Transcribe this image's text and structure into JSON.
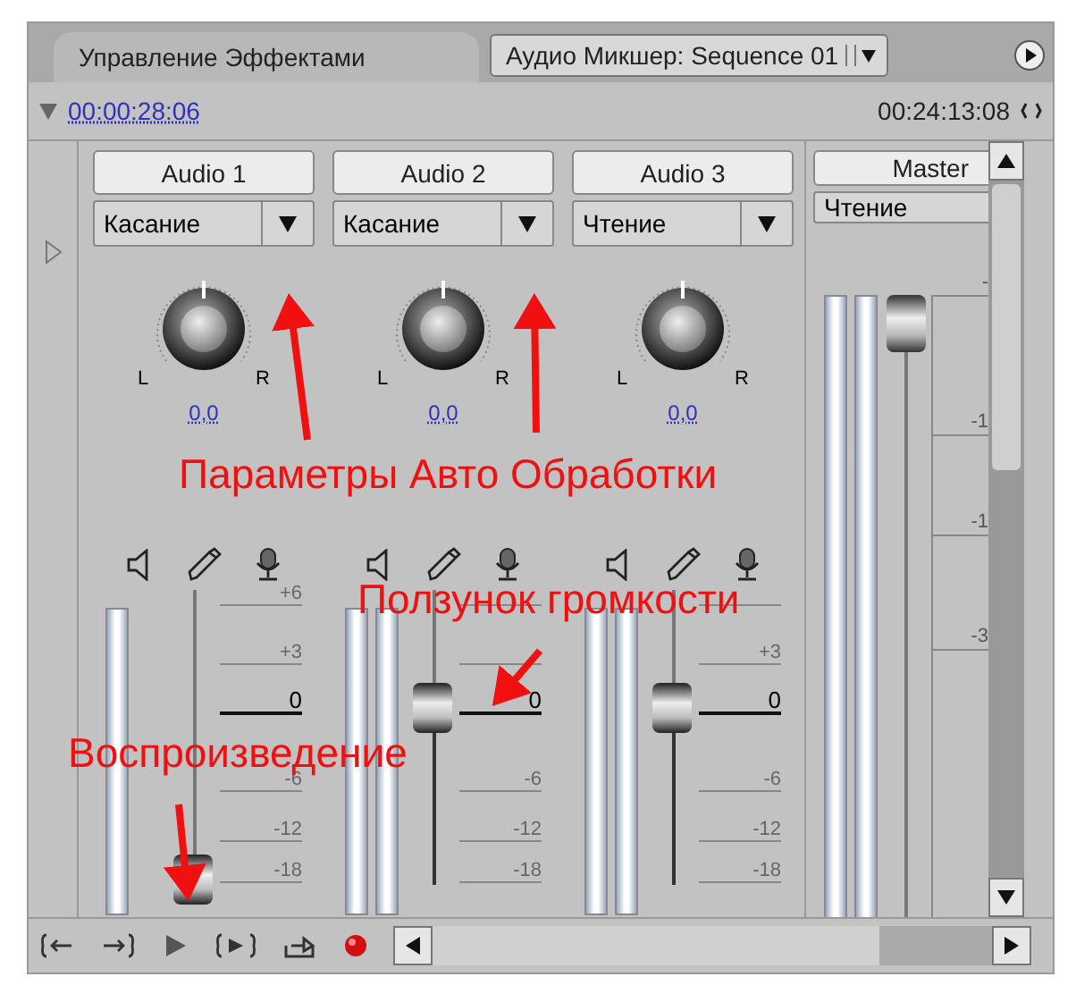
{
  "tabs": [
    {
      "label": "Управление Эффектами",
      "selected": false
    },
    {
      "label": "Аудио Микшер: Sequence 01",
      "selected": true
    }
  ],
  "timecodes": {
    "current": "00:00:28:06",
    "duration": "00:24:13:08"
  },
  "channels": [
    {
      "name": "Audio 1",
      "mode": "Касание",
      "left": "L",
      "right": "R",
      "pan": "0,0",
      "kind": "mono",
      "level": 0.02,
      "ticks": [
        {
          "kind": "p6",
          "label": "+6"
        },
        {
          "kind": "p3",
          "label": "+3"
        },
        {
          "kind": "zero",
          "label": "0"
        },
        {
          "kind": "m6",
          "label": "-6"
        },
        {
          "kind": "m12",
          "label": "-12"
        },
        {
          "kind": "m18",
          "label": "-18"
        }
      ]
    },
    {
      "name": "Audio 2",
      "mode": "Касание",
      "left": "L",
      "right": "R",
      "pan": "0,0",
      "kind": "stereo",
      "level": 0.6,
      "ticks": [
        {
          "kind": "zero",
          "label": "0"
        },
        {
          "kind": "m6",
          "label": "-6"
        },
        {
          "kind": "m12",
          "label": "-12"
        },
        {
          "kind": "m18",
          "label": "-18"
        }
      ]
    },
    {
      "name": "Audio 3",
      "mode": "Чтение",
      "left": "L",
      "right": "R",
      "pan": "0,0",
      "kind": "stereo",
      "level": 0.6,
      "ticks": [
        {
          "kind": "p3",
          "label": "+3"
        },
        {
          "kind": "zero",
          "label": "0"
        },
        {
          "kind": "m6",
          "label": "-6"
        },
        {
          "kind": "m12",
          "label": "-12"
        },
        {
          "kind": "m18",
          "label": "-18"
        }
      ]
    }
  ],
  "master": {
    "name": "Master",
    "mode": "Чтение",
    "ticks": [
      "-",
      "-1",
      "-1",
      "-3"
    ]
  },
  "annotations": [
    {
      "text": "Параметры Авто Обработки"
    },
    {
      "text": "Ползунок громкости"
    },
    {
      "text": "Воспроизведение"
    }
  ]
}
